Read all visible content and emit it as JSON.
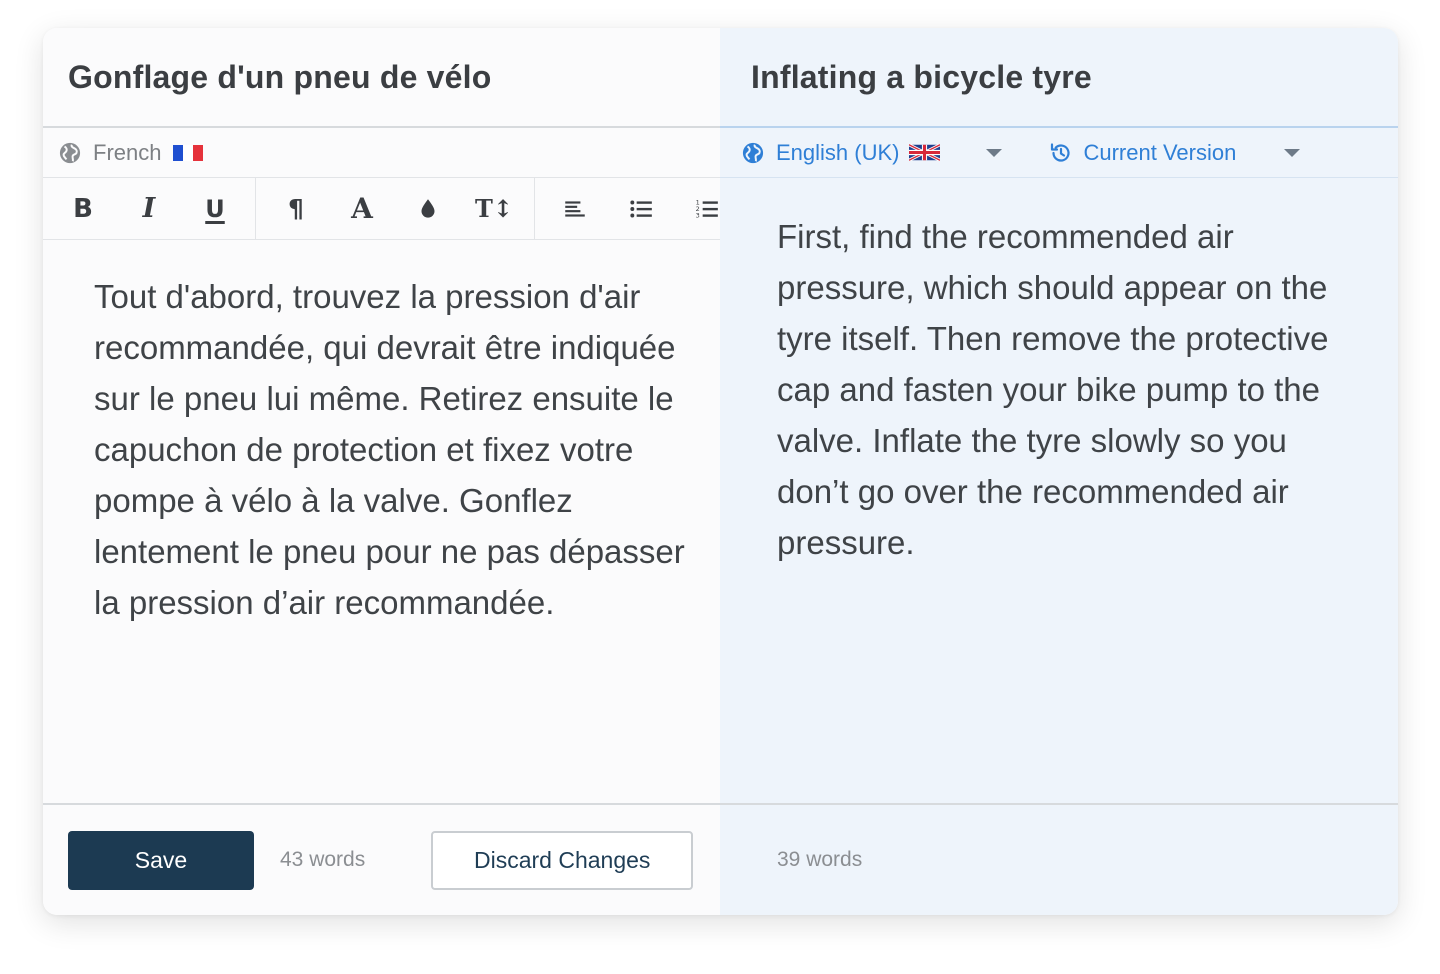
{
  "source": {
    "title": "Gonflage d'un pneu de vélo",
    "language": "French",
    "flag": "fr-flag-icon",
    "toolbar": [
      "bold-icon",
      "italic-icon",
      "underline-icon",
      "paragraph-icon",
      "text-color-icon",
      "highlight-icon",
      "font-size-icon",
      "align-left-icon",
      "bullet-list-icon",
      "numbered-list-icon"
    ],
    "body": "Tout d'abord, trouvez la pression d'air recommandée, qui devrait être indiquée sur le pneu lui même. Retirez ensuite le capuchon de protection et fixez votre pompe à vélo à la valve. Gonflez lentement le pneu pour ne pas dépasser la pression d’air recommandée.",
    "save_label": "Save",
    "word_count": "43 words",
    "discard_label": "Discard Changes"
  },
  "target": {
    "title": "Inflating a bicycle tyre",
    "language": "English (UK)",
    "flag": "uk-flag-icon",
    "version_label": "Current Version",
    "body": "First, find the recommended air pressure, which should appear on the tyre itself. Then remove the protective cap and fasten your bike pump to the valve. Inflate the tyre slowly so you don’t go over the recommended air pressure.",
    "word_count": "39 words"
  },
  "colors": {
    "accent": "#2f7fd6",
    "save_button": "#1c3a52",
    "right_pane_bg": "#eef4fb"
  }
}
